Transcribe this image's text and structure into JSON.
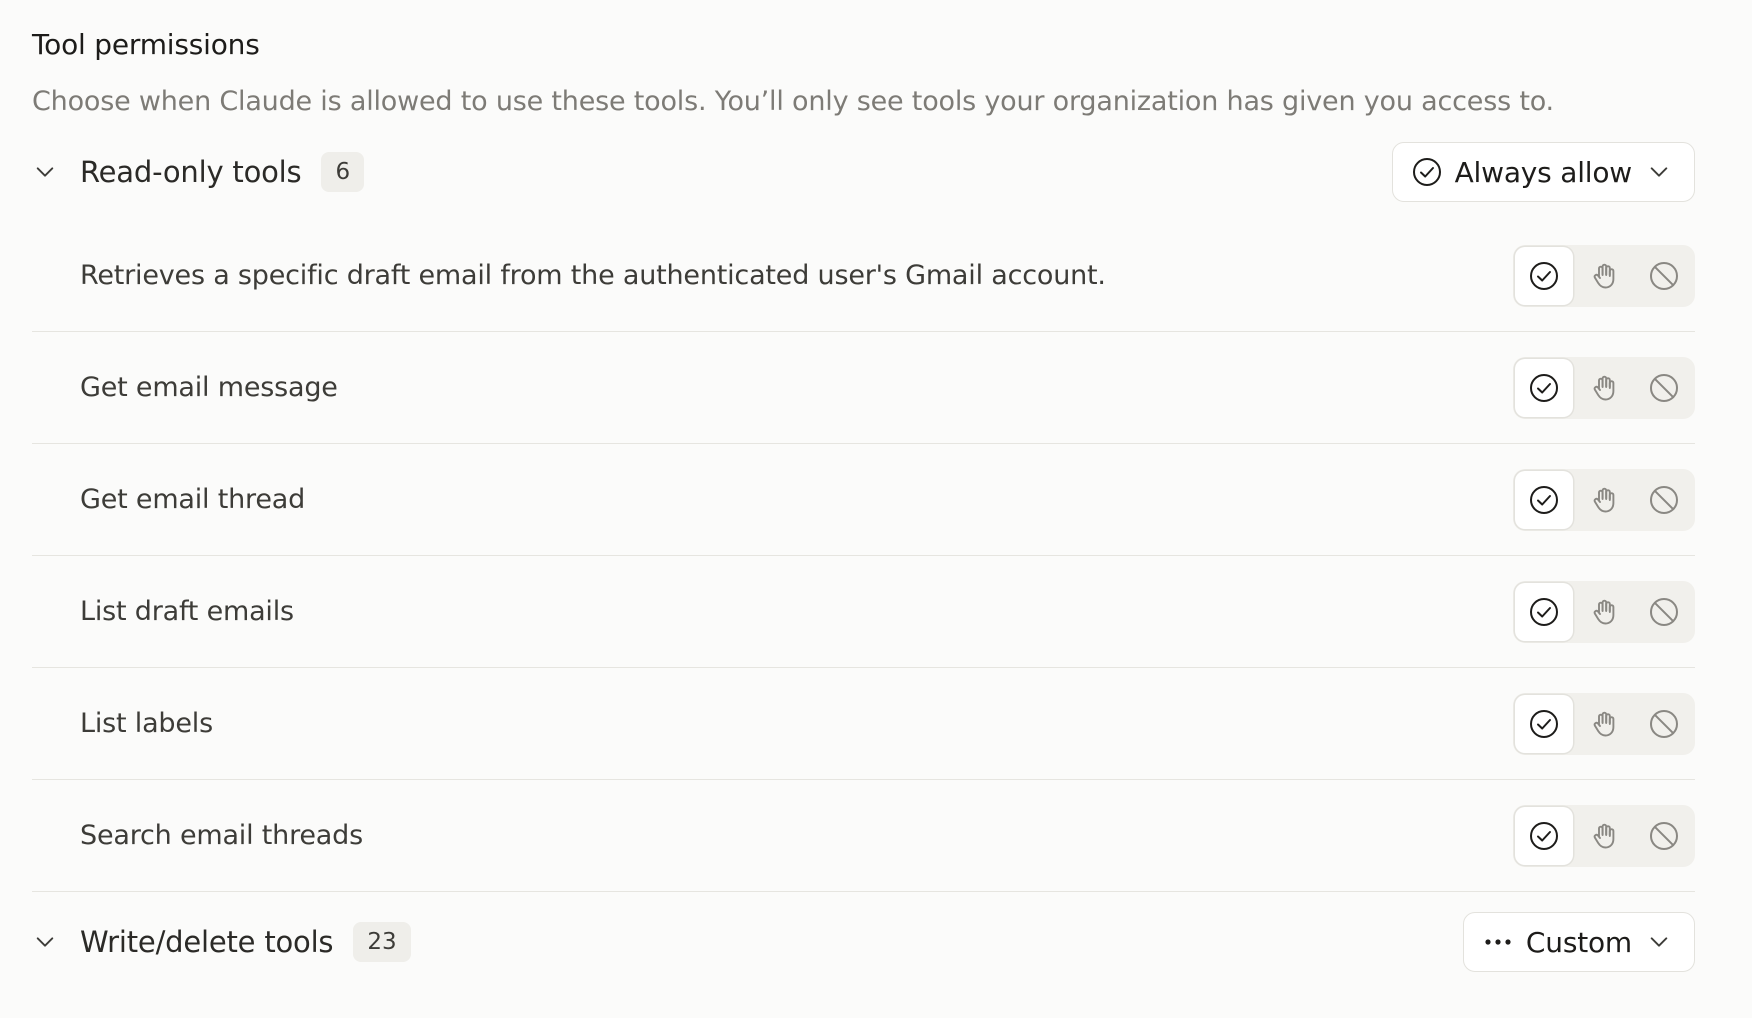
{
  "header": {
    "title": "Tool permissions",
    "subtitle": "Choose when Claude is allowed to use these tools. You’ll only see tools your organization has given you access to."
  },
  "groups": [
    {
      "label": "Read-only tools",
      "count": "6",
      "expanded": true,
      "dropdown": {
        "icon": "check-circle-icon",
        "label": "Always allow"
      },
      "tools": [
        {
          "label": "Retrieves a specific draft email from the authenticated user's Gmail account.",
          "permission": "always-allow"
        },
        {
          "label": "Get email message",
          "permission": "always-allow"
        },
        {
          "label": "Get email thread",
          "permission": "always-allow"
        },
        {
          "label": "List draft emails",
          "permission": "always-allow"
        },
        {
          "label": "List labels",
          "permission": "always-allow"
        },
        {
          "label": "Search email threads",
          "permission": "always-allow"
        }
      ]
    },
    {
      "label": "Write/delete tools",
      "count": "23",
      "expanded": true,
      "dropdown": {
        "icon": "more-horizontal-icon",
        "label": "Custom"
      }
    }
  ],
  "permission_options": [
    "always-allow",
    "ask-permission",
    "never-allow"
  ],
  "colors": {
    "background": "#fbfbfa",
    "active_icon": "#1d1c1a",
    "inactive_icon": "#8a8883",
    "divider": "#e6e5e0"
  }
}
